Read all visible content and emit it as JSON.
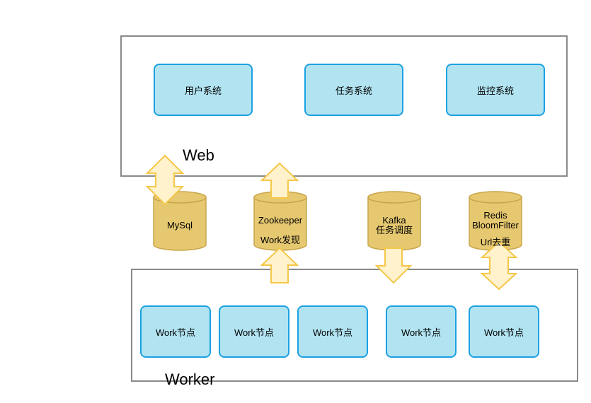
{
  "web": {
    "label": "Web",
    "systems": [
      "用户系统",
      "任务系统",
      "监控系统"
    ]
  },
  "storage": {
    "mysql": "MySql",
    "zookeeper_line1": "Zookeeper",
    "zookeeper_line2": "Work发现",
    "kafka_line1": "Kafka",
    "kafka_line2": "任务调度",
    "redis_line1": "Redis",
    "redis_line2": "BloomFilter",
    "redis_line3": "Url去重"
  },
  "worker": {
    "label": "Worker",
    "nodes": [
      "Work节点",
      "Work节点",
      "Work节点",
      "Work节点",
      "Work节点"
    ]
  },
  "colors": {
    "node_fill": "#b1e3f1",
    "node_border": "#1ba1e2",
    "cylinder_fill": "#e6c870",
    "cylinder_border": "#c9a54a",
    "arrow_fill": "#fff2cc",
    "arrow_border": "#f5c74a"
  }
}
